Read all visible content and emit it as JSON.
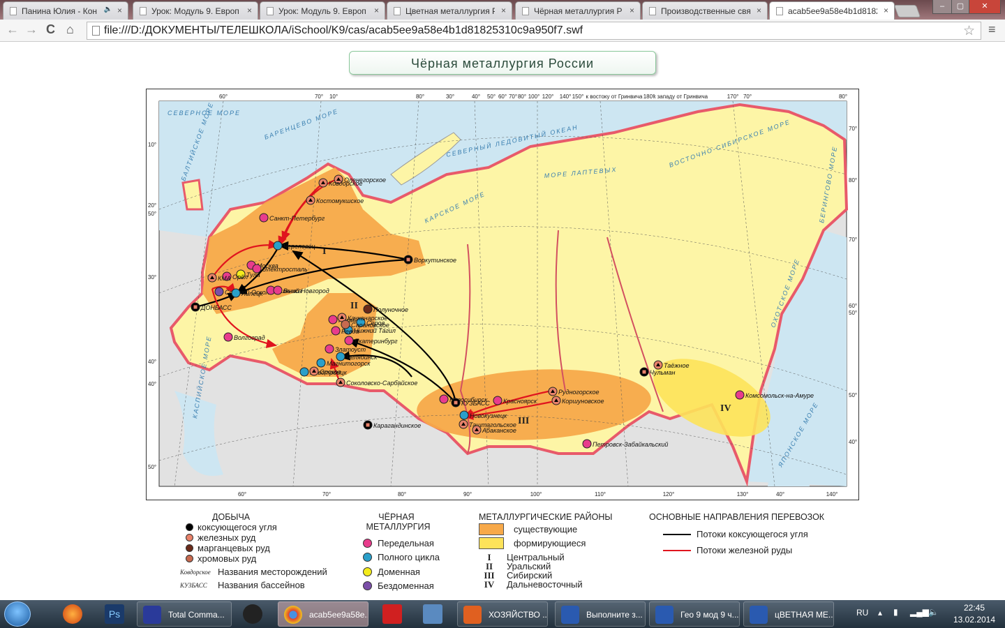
{
  "browser": {
    "tabs": [
      {
        "title": "Панина Юлия - Кон",
        "audio": true
      },
      {
        "title": "Урок: Модуль 9. Европ"
      },
      {
        "title": "Урок: Модуль 9. Европ"
      },
      {
        "title": "Цветная металлургия Р"
      },
      {
        "title": "Чёрная металлургия Р"
      },
      {
        "title": "Производственные свя"
      },
      {
        "title": "acab5ee9a58e4b1d81825",
        "active": true
      }
    ],
    "url": "file:///D:/ДОКУМЕНТЫ/ТЕЛЕШКОЛА/iSchool/K9/cas/acab5ee9a58e4b1d81825310c9a950f7.swf",
    "icons": {
      "back": "←",
      "forward": "→",
      "reload": "C",
      "home": "⌂",
      "star": "☆",
      "menu": "≡",
      "close_tab": "×",
      "audio": "🔈"
    }
  },
  "page": {
    "title": "Чёрная металлургия России"
  },
  "map": {
    "ticks_top": [
      "60°",
      "70°",
      "10°",
      "80°",
      "30°",
      "40°",
      "50°",
      "60°",
      "70°",
      "80°",
      "100°",
      "120°",
      "140°",
      "150°",
      "к востоку от Гринвича",
      "180°",
      "к западу от Гринвича",
      "170°",
      "70°",
      "80°"
    ],
    "ticks_bottom": [
      "60°",
      "70°",
      "80°",
      "90°",
      "100°",
      "110°",
      "120°",
      "130°",
      "40°",
      "140°"
    ],
    "ticks_left": [
      "10°",
      "20°",
      "50°",
      "30°",
      "40°",
      "40°",
      "50°"
    ],
    "ticks_right": [
      "70°",
      "80°",
      "70°",
      "60°",
      "50°",
      "50°",
      "40°"
    ],
    "seas": [
      "СЕВЕРНЫЙ ЛЕДОВИТЫЙ ОКЕАН",
      "БАРЕНЦЕВО МОРЕ",
      "КАРСКОЕ МОРЕ",
      "МОРЕ ЛАПТЕВЫХ",
      "ВОСТОЧНО-СИБИРСКОЕ МОРЕ",
      "БЕРИНГОВО МОРЕ",
      "ОХОТСКОЕ МОРЕ",
      "ЯПОНСКОЕ МОРЕ",
      "КАСПИЙСКОЕ МОРЕ",
      "БАЛТИЙСКОЕ МОРЕ",
      "СЕВЕРНОЕ МОРЕ"
    ],
    "regions": [
      "I",
      "II",
      "III",
      "IV"
    ],
    "points": [
      {
        "name": "Оленегорское",
        "type": "iron"
      },
      {
        "name": "Ковдорское",
        "type": "iron"
      },
      {
        "name": "Костомукшское",
        "type": "iron"
      },
      {
        "name": "Санкт-Петербург",
        "type": "peredel"
      },
      {
        "name": "Череповец",
        "type": "full"
      },
      {
        "name": "Воркутинское",
        "type": "coal"
      },
      {
        "name": "Москва",
        "type": "peredel"
      },
      {
        "name": "Электросталь",
        "type": "peredel"
      },
      {
        "name": "Тула",
        "type": "blast"
      },
      {
        "name": "Орёл",
        "type": "peredel"
      },
      {
        "name": "КМА",
        "type": "iron"
      },
      {
        "name": "Старый Оскол",
        "type": "noblast"
      },
      {
        "name": "Липецк",
        "type": "full"
      },
      {
        "name": "Нижний Новгород",
        "type": "peredel"
      },
      {
        "name": "Выкса",
        "type": "peredel"
      },
      {
        "name": "ДОНБАСС",
        "type": "coal"
      },
      {
        "name": "Волгоград",
        "type": "peredel"
      },
      {
        "name": "Полуночное",
        "type": "manganese"
      },
      {
        "name": "Пермь",
        "type": "peredel"
      },
      {
        "name": "Серов",
        "type": "full"
      },
      {
        "name": "Нижний Тагил",
        "type": "full"
      },
      {
        "name": "Качканарское",
        "type": "iron"
      },
      {
        "name": "Сарановское",
        "type": "chrome"
      },
      {
        "name": "Ревда",
        "type": "peredel"
      },
      {
        "name": "Екатеринбург",
        "type": "peredel"
      },
      {
        "name": "Златоуст",
        "type": "peredel"
      },
      {
        "name": "Челябинск",
        "type": "full"
      },
      {
        "name": "Магнитогорск",
        "type": "full"
      },
      {
        "name": "Новотроицк",
        "type": "full"
      },
      {
        "name": "Орское",
        "type": "iron"
      },
      {
        "name": "Соколовско-Сарбайское",
        "type": "iron"
      },
      {
        "name": "Карагандинское",
        "type": "coal"
      },
      {
        "name": "Новосибирск",
        "type": "peredel"
      },
      {
        "name": "КУЗБАСС",
        "type": "coal"
      },
      {
        "name": "Новокузнецк",
        "type": "full"
      },
      {
        "name": "Таштагольское",
        "type": "iron"
      },
      {
        "name": "Абаканское",
        "type": "iron"
      },
      {
        "name": "Красноярск",
        "type": "peredel"
      },
      {
        "name": "Рудногорское",
        "type": "iron"
      },
      {
        "name": "Коршуновское",
        "type": "iron"
      },
      {
        "name": "Петровск-Забайкальский",
        "type": "peredel"
      },
      {
        "name": "Чульман",
        "type": "coal"
      },
      {
        "name": "Таёжное",
        "type": "iron"
      },
      {
        "name": "Комсомольск-на-Амуре",
        "type": "peredel"
      }
    ]
  },
  "legend": {
    "mining": {
      "title": "ДОБЫЧА",
      "items": [
        "коксующегося угля",
        "железных руд",
        "марганцевых руд",
        "хромовых руд"
      ],
      "deposit_sample": "Ковдорское",
      "deposit_label": "Названия месторождений",
      "basin_sample": "КУЗБАСС",
      "basin_label": "Названия бассейнов"
    },
    "metallurgy": {
      "title_1": "ЧЁРНАЯ",
      "title_2": "МЕТАЛЛУРГИЯ",
      "items": [
        {
          "label": "Передельная",
          "color": "#e83c8c"
        },
        {
          "label": "Полного цикла",
          "color": "#2a9fc9"
        },
        {
          "label": "Доменная",
          "color": "#f4ec1c"
        },
        {
          "label": "Бездоменная",
          "color": "#7b4fa8"
        }
      ]
    },
    "regions": {
      "title": "МЕТАЛЛУРГИЧЕСКИЕ РАЙОНЫ",
      "existing": "существующие",
      "existing_color": "#f7a94a",
      "forming": "формирующиеся",
      "forming_color": "#fde35a",
      "list": [
        {
          "num": "I",
          "name": "Центральный"
        },
        {
          "num": "II",
          "name": "Уральский"
        },
        {
          "num": "III",
          "name": "Сибирский"
        },
        {
          "num": "IV",
          "name": "Дальневосточный"
        }
      ]
    },
    "transport": {
      "title": "ОСНОВНЫЕ НАПРАВЛЕНИЯ ПЕРЕВОЗОК",
      "coal": "Потоки коксующегося угля",
      "coal_color": "#000000",
      "iron": "Потоки железной руды",
      "iron_color": "#e0141e"
    }
  },
  "taskbar": {
    "items": [
      {
        "label": "Total Comma...",
        "icon": "floppy-icon"
      },
      {
        "label": "acab5ee9a58e...",
        "icon": "chrome-icon",
        "active": true
      },
      {
        "label": "ХОЗЯЙСТВО ...",
        "icon": "powerpoint-icon"
      },
      {
        "label": "Выполните з...",
        "icon": "word-icon"
      },
      {
        "label": "Гео 9 мод 9 ч...",
        "icon": "word-icon"
      },
      {
        "label": "цВЕТНАЯ МЕ...",
        "icon": "word-icon"
      }
    ],
    "lang": "RU",
    "time": "22:45",
    "date": "13.02.2014"
  }
}
